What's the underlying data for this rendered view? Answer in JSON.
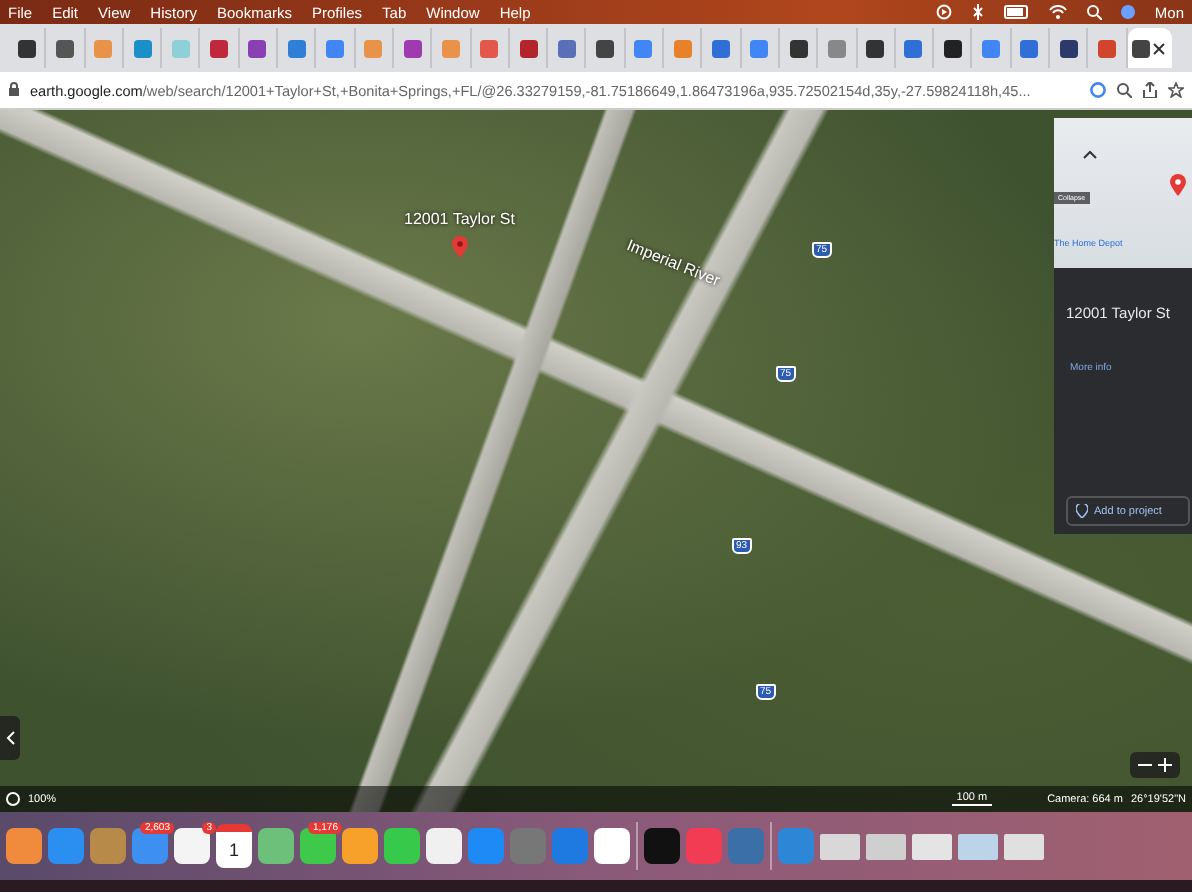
{
  "menu_bar": {
    "items": [
      "File",
      "Edit",
      "View",
      "History",
      "Bookmarks",
      "Profiles",
      "Tab",
      "Window",
      "Help"
    ],
    "clock": "Mon"
  },
  "tabs": [
    {
      "color": "#333333",
      "selected": false
    },
    {
      "color": "#555555",
      "selected": false
    },
    {
      "color": "#e8924a",
      "selected": false
    },
    {
      "color": "#1a8fc9",
      "selected": false
    },
    {
      "color": "#8fd0d8",
      "selected": false
    },
    {
      "color": "#c0283b",
      "selected": false
    },
    {
      "color": "#8a3fb5",
      "selected": false
    },
    {
      "color": "#2f7fd6",
      "selected": false
    },
    {
      "color": "#4285f4",
      "selected": false
    },
    {
      "color": "#e8924a",
      "selected": false
    },
    {
      "color": "#a03ab0",
      "selected": false
    },
    {
      "color": "#e8924a",
      "selected": false
    },
    {
      "color": "#e2584a",
      "selected": false
    },
    {
      "color": "#b0262b",
      "selected": false
    },
    {
      "color": "#5b6fb8",
      "selected": false
    },
    {
      "color": "#444444",
      "selected": false
    },
    {
      "color": "#4285f4",
      "selected": false
    },
    {
      "color": "#e8822a",
      "selected": false
    },
    {
      "color": "#2f6fd6",
      "selected": false
    },
    {
      "color": "#4285f4",
      "selected": false
    },
    {
      "color": "#333333",
      "selected": false
    },
    {
      "color": "#888888",
      "selected": false
    },
    {
      "color": "#333333",
      "selected": false
    },
    {
      "color": "#2f6fd6",
      "selected": false
    },
    {
      "color": "#222222",
      "selected": false
    },
    {
      "color": "#4285f4",
      "selected": false
    },
    {
      "color": "#2f6fd6",
      "selected": false
    },
    {
      "color": "#2b3a6b",
      "selected": false
    },
    {
      "color": "#d2452d",
      "selected": false
    },
    {
      "color": "#444444",
      "selected": true
    }
  ],
  "address_bar": {
    "host": "earth.google.com",
    "path": "/web/search/12001+Taylor+St,+Bonita+Springs,+FL/@26.33279159,-81.75186649,1.86473196a,935.72502154d,35y,-27.59824118h,45..."
  },
  "map": {
    "labels": [
      {
        "kind": "place",
        "text": "12001 Taylor St"
      },
      {
        "kind": "river",
        "text": "Imperial River"
      },
      {
        "kind": "shield",
        "text": "75"
      },
      {
        "kind": "shield",
        "text": "75"
      },
      {
        "kind": "shield",
        "text": "93"
      },
      {
        "kind": "shield",
        "text": "75"
      }
    ],
    "panel": {
      "collapse": "Collapse",
      "poi": "The Home Depot",
      "title": "12001 Taylor St",
      "more": "More info",
      "action": "Add to project"
    },
    "status": {
      "zoom": "100%",
      "scale": "100 m",
      "camera": "Camera: 664 m",
      "coords": "26°19'52\"N"
    }
  },
  "dock": {
    "items": [
      {
        "kind": "app",
        "color": "#f08a3c"
      },
      {
        "kind": "app",
        "color": "#2a8ff0"
      },
      {
        "kind": "app",
        "color": "#b88a4a"
      },
      {
        "kind": "app",
        "color": "#3d8ff0",
        "badge": "2,603"
      },
      {
        "kind": "app",
        "color": "#f4f4f4",
        "badge": "3"
      },
      {
        "kind": "calendar",
        "color": "#ffffff",
        "date": "1"
      },
      {
        "kind": "app",
        "color": "#6cc07a"
      },
      {
        "kind": "app",
        "color": "#3ec94a",
        "badge": "1,176"
      },
      {
        "kind": "app",
        "color": "#f7a02a"
      },
      {
        "kind": "app",
        "color": "#36c94a"
      },
      {
        "kind": "app",
        "color": "#f0f0f0"
      },
      {
        "kind": "app",
        "color": "#1e8af5"
      },
      {
        "kind": "app",
        "color": "#777777"
      },
      {
        "kind": "app",
        "color": "#1e7ae0"
      },
      {
        "kind": "app",
        "color": "#ffffff"
      },
      {
        "kind": "separator"
      },
      {
        "kind": "app",
        "color": "#111111"
      },
      {
        "kind": "app",
        "color": "#f23c54"
      },
      {
        "kind": "app",
        "color": "#3a6fa8"
      },
      {
        "kind": "separator"
      },
      {
        "kind": "app",
        "color": "#2e86d6"
      },
      {
        "kind": "window",
        "color": "#d8d8d8"
      },
      {
        "kind": "window",
        "color": "#cfcfcf"
      },
      {
        "kind": "window",
        "color": "#e4e4e4"
      },
      {
        "kind": "window",
        "color": "#bcd4ea"
      },
      {
        "kind": "window",
        "color": "#e0e0e0"
      }
    ]
  }
}
